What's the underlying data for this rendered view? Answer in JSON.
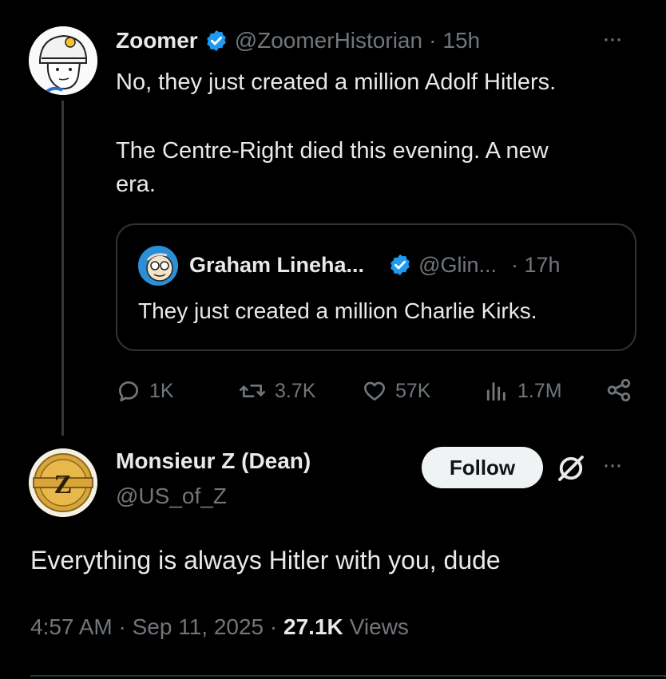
{
  "parent_tweet": {
    "display_name": "Zoomer",
    "handle": "@ZoomerHistorian",
    "separator": "·",
    "time": "15h",
    "more": "···",
    "text_line1": "No, they just created a million Adolf Hitlers.",
    "text_line2": "The Centre-Right died this evening. A new",
    "text_line3": "era."
  },
  "quoted_tweet": {
    "display_name": "Graham Lineha...",
    "handle": "@Glin...",
    "time": "· 17h",
    "text": "They just created a million Charlie Kirks."
  },
  "actions": {
    "replies": "1K",
    "reposts": "3.7K",
    "likes": "57K",
    "views": "1.7M"
  },
  "reply_tweet": {
    "display_name": "Monsieur Z (Dean)",
    "handle": "@US_of_Z",
    "follow_label": "Follow",
    "more": "···",
    "text": "Everything is always Hitler with you, dude",
    "timestamp": "4:57 AM · Sep 11, 2025 · ",
    "views_count": "27.1K",
    "views_label": "Views"
  },
  "colors": {
    "verified": "#1d9bf0",
    "background": "#000000",
    "muted": "#71767b",
    "follow_bg": "#eff3f4"
  }
}
